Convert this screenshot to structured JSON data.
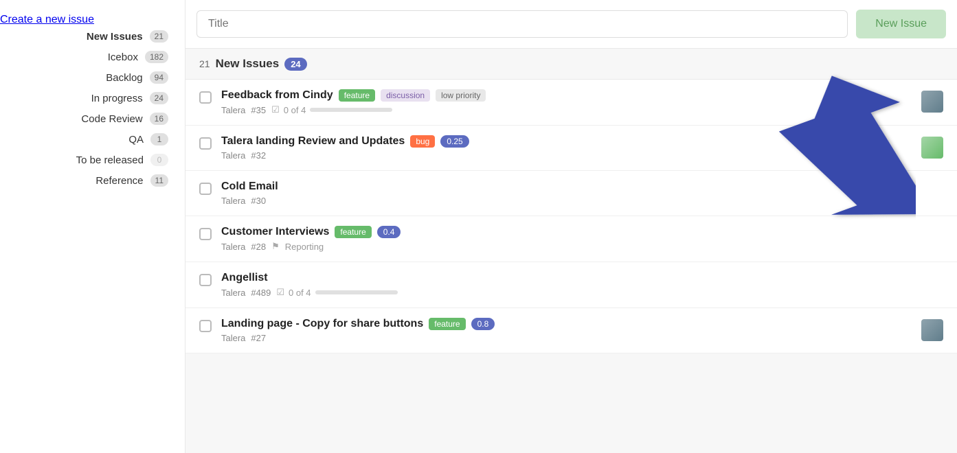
{
  "sidebar": {
    "create_label": "Create a new issue",
    "items": [
      {
        "id": "new-issues",
        "label": "New Issues",
        "count": "21",
        "active": true,
        "zero": false
      },
      {
        "id": "icebox",
        "label": "Icebox",
        "count": "182",
        "active": false,
        "zero": false
      },
      {
        "id": "backlog",
        "label": "Backlog",
        "count": "94",
        "active": false,
        "zero": false
      },
      {
        "id": "in-progress",
        "label": "In progress",
        "count": "24",
        "active": false,
        "zero": false
      },
      {
        "id": "code-review",
        "label": "Code Review",
        "count": "16",
        "active": false,
        "zero": false
      },
      {
        "id": "qa",
        "label": "QA",
        "count": "1",
        "active": false,
        "zero": false
      },
      {
        "id": "to-be-released",
        "label": "To be released",
        "count": "0",
        "active": false,
        "zero": true
      },
      {
        "id": "reference",
        "label": "Reference",
        "count": "11",
        "active": false,
        "zero": false
      }
    ]
  },
  "topbar": {
    "title_placeholder": "Title",
    "new_issue_label": "New Issue"
  },
  "section": {
    "count": "21",
    "title": "New Issues",
    "badge": "24"
  },
  "issues": [
    {
      "id": "issue-1",
      "title": "Feedback from Cindy",
      "tags": [
        {
          "type": "feature",
          "label": "feature"
        },
        {
          "type": "discussion",
          "label": "discussion"
        },
        {
          "type": "low-priority",
          "label": "low priority"
        }
      ],
      "project": "Talera",
      "issue_num": "#35",
      "progress_text": "0 of 4",
      "progress_pct": 0,
      "has_avatar": true,
      "avatar_type": "1",
      "has_milestone": false
    },
    {
      "id": "issue-2",
      "title": "Talera landing Review and Updates",
      "tags": [
        {
          "type": "bug",
          "label": "bug"
        },
        {
          "type": "score",
          "label": "0.25"
        }
      ],
      "project": "Talera",
      "issue_num": "#32",
      "progress_text": "",
      "progress_pct": 0,
      "has_avatar": true,
      "avatar_type": "2",
      "has_milestone": false
    },
    {
      "id": "issue-3",
      "title": "Cold Email",
      "tags": [],
      "project": "Talera",
      "issue_num": "#30",
      "progress_text": "",
      "progress_pct": 0,
      "has_avatar": false,
      "has_milestone": false
    },
    {
      "id": "issue-4",
      "title": "Customer Interviews",
      "tags": [
        {
          "type": "feature",
          "label": "feature"
        },
        {
          "type": "score",
          "label": "0.4"
        }
      ],
      "project": "Talera",
      "issue_num": "#28",
      "progress_text": "",
      "progress_pct": 0,
      "has_avatar": false,
      "has_milestone": true,
      "milestone_label": "Reporting"
    },
    {
      "id": "issue-5",
      "title": "Angellist",
      "tags": [],
      "project": "Talera",
      "issue_num": "#489",
      "progress_text": "0 of 4",
      "progress_pct": 0,
      "has_avatar": false,
      "has_milestone": false
    },
    {
      "id": "issue-6",
      "title": "Landing page - Copy for share buttons",
      "tags": [
        {
          "type": "feature",
          "label": "feature"
        },
        {
          "type": "score",
          "label": "0.8"
        }
      ],
      "project": "Talera",
      "issue_num": "#27",
      "progress_text": "",
      "progress_pct": 0,
      "has_avatar": true,
      "avatar_type": "1",
      "has_milestone": false
    }
  ]
}
